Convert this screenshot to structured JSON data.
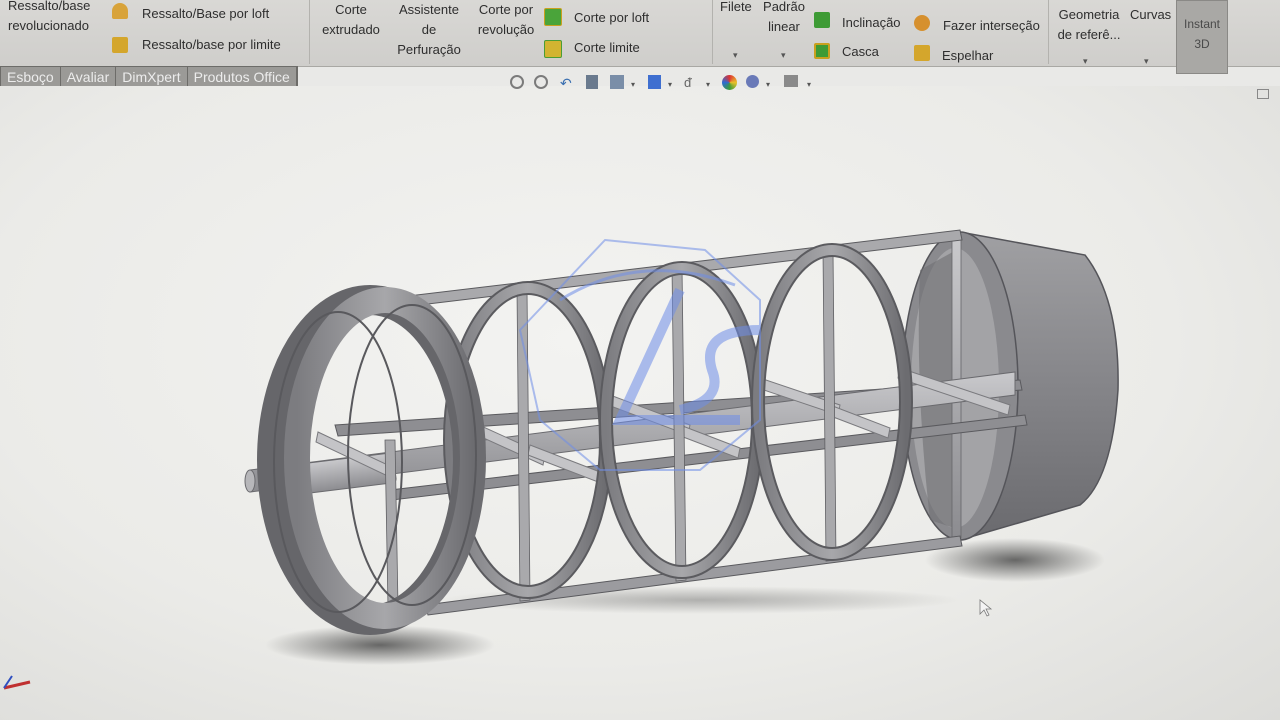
{
  "ribbon": {
    "boss_revolved": "Ressalto/base\nrevolucionado",
    "boss_revolved_l1": "Ressalto/base",
    "boss_revolved_l2": "revolucionado",
    "boss_loft": "Ressalto/Base por loft",
    "boss_boundary": "Ressalto/base por limite",
    "cut_extrude_l1": "Corte",
    "cut_extrude_l2": "extrudado",
    "hole_wizard_l1": "Assistente",
    "hole_wizard_l2": "de",
    "hole_wizard_l3": "Perfuração",
    "cut_revolve_l1": "Corte por",
    "cut_revolve_l2": "revolução",
    "cut_loft": "Corte por loft",
    "cut_boundary": "Corte limite",
    "fillet": "Filete",
    "linear_pattern_l1": "Padrão",
    "linear_pattern_l2": "linear",
    "draft": "Inclinação",
    "shell": "Casca",
    "intersect": "Fazer interseção",
    "mirror": "Espelhar",
    "ref_geometry_l1": "Geometria",
    "ref_geometry_l2": "de referê...",
    "curves": "Curvas",
    "instant3d_l1": "Instant",
    "instant3d_l2": "3D"
  },
  "tabs": [
    {
      "label": "Esboço"
    },
    {
      "label": "Avaliar"
    },
    {
      "label": "DimXpert"
    },
    {
      "label": "Produtos Office"
    }
  ],
  "hud_icons": [
    "zoom-to-fit-icon",
    "zoom-area-icon",
    "previous-view-icon",
    "section-view-icon",
    "view-orientation-icon",
    "display-style-icon",
    "hide-show-icon",
    "appearance-icon",
    "scene-icon",
    "display-settings-icon"
  ],
  "colors": {
    "ribbon_bg": "#d4d3d0",
    "viewport_bg": "#ececea",
    "model_fill": "#9a9a9d",
    "model_dark": "#6e6e72",
    "watermark": "#6f8ee8"
  }
}
